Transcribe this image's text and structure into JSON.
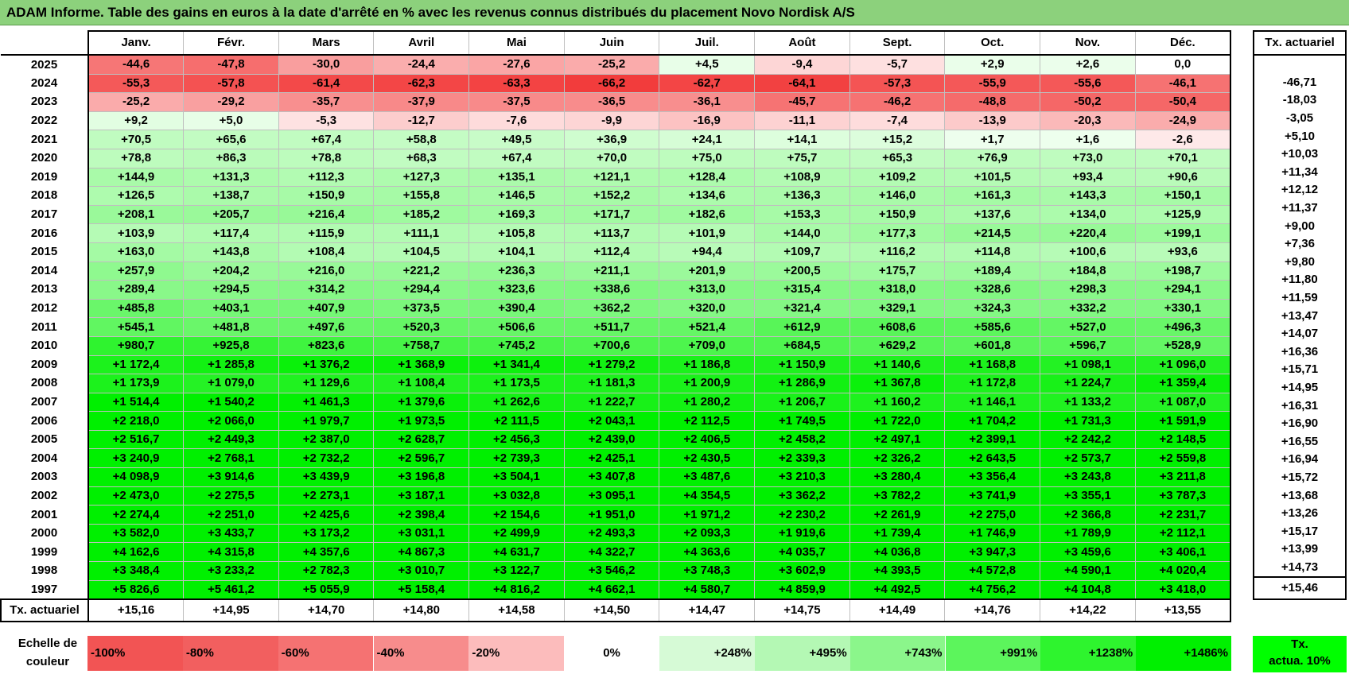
{
  "title": "ADAM Informe. Table des gains en euros à la date d'arrêté en % avec les revenus connus distribués du placement Novo Nordisk A/S",
  "months": [
    "Janv.",
    "Févr.",
    "Mars",
    "Avril",
    "Mai",
    "Juin",
    "Juil.",
    "Août",
    "Sept.",
    "Oct.",
    "Nov.",
    "Déc."
  ],
  "rate_header": "Tx. actuariel",
  "rows": [
    {
      "year": "2025",
      "values": [
        "-44,6",
        "-47,8",
        "-30,0",
        "-24,4",
        "-27,6",
        "-25,2",
        "+4,5",
        "-9,4",
        "-5,7",
        "+2,9",
        "+2,6",
        "0,0"
      ],
      "rate": ""
    },
    {
      "year": "2024",
      "values": [
        "-55,3",
        "-57,8",
        "-61,4",
        "-62,3",
        "-63,3",
        "-66,2",
        "-62,7",
        "-64,1",
        "-57,3",
        "-55,9",
        "-55,6",
        "-46,1"
      ],
      "rate": "-46,71"
    },
    {
      "year": "2023",
      "values": [
        "-25,2",
        "-29,2",
        "-35,7",
        "-37,9",
        "-37,5",
        "-36,5",
        "-36,1",
        "-45,7",
        "-46,2",
        "-48,8",
        "-50,2",
        "-50,4"
      ],
      "rate": "-18,03"
    },
    {
      "year": "2022",
      "values": [
        "+9,2",
        "+5,0",
        "-5,3",
        "-12,7",
        "-7,6",
        "-9,9",
        "-16,9",
        "-11,1",
        "-7,4",
        "-13,9",
        "-20,3",
        "-24,9"
      ],
      "rate": "-3,05"
    },
    {
      "year": "2021",
      "values": [
        "+70,5",
        "+65,6",
        "+67,4",
        "+58,8",
        "+49,5",
        "+36,9",
        "+24,1",
        "+14,1",
        "+15,2",
        "+1,7",
        "+1,6",
        "-2,6"
      ],
      "rate": "+5,10"
    },
    {
      "year": "2020",
      "values": [
        "+78,8",
        "+86,3",
        "+78,8",
        "+68,3",
        "+67,4",
        "+70,0",
        "+75,0",
        "+75,7",
        "+65,3",
        "+76,9",
        "+73,0",
        "+70,1"
      ],
      "rate": "+10,03"
    },
    {
      "year": "2019",
      "values": [
        "+144,9",
        "+131,3",
        "+112,3",
        "+127,3",
        "+135,1",
        "+121,1",
        "+128,4",
        "+108,9",
        "+109,2",
        "+101,5",
        "+93,4",
        "+90,6"
      ],
      "rate": "+11,34"
    },
    {
      "year": "2018",
      "values": [
        "+126,5",
        "+138,7",
        "+150,9",
        "+155,8",
        "+146,5",
        "+152,2",
        "+134,6",
        "+136,3",
        "+146,0",
        "+161,3",
        "+143,3",
        "+150,1"
      ],
      "rate": "+12,12"
    },
    {
      "year": "2017",
      "values": [
        "+208,1",
        "+205,7",
        "+216,4",
        "+185,2",
        "+169,3",
        "+171,7",
        "+182,6",
        "+153,3",
        "+150,9",
        "+137,6",
        "+134,0",
        "+125,9"
      ],
      "rate": "+11,37"
    },
    {
      "year": "2016",
      "values": [
        "+103,9",
        "+117,4",
        "+115,9",
        "+111,1",
        "+105,8",
        "+113,7",
        "+101,9",
        "+144,0",
        "+177,3",
        "+214,5",
        "+220,4",
        "+199,1"
      ],
      "rate": "+9,00"
    },
    {
      "year": "2015",
      "values": [
        "+163,0",
        "+143,8",
        "+108,4",
        "+104,5",
        "+104,1",
        "+112,4",
        "+94,4",
        "+109,7",
        "+116,2",
        "+114,8",
        "+100,6",
        "+93,6"
      ],
      "rate": "+7,36"
    },
    {
      "year": "2014",
      "values": [
        "+257,9",
        "+204,2",
        "+216,0",
        "+221,2",
        "+236,3",
        "+211,1",
        "+201,9",
        "+200,5",
        "+175,7",
        "+189,4",
        "+184,8",
        "+198,7"
      ],
      "rate": "+9,80"
    },
    {
      "year": "2013",
      "values": [
        "+289,4",
        "+294,5",
        "+314,2",
        "+294,4",
        "+323,6",
        "+338,6",
        "+313,0",
        "+315,4",
        "+318,0",
        "+328,6",
        "+298,3",
        "+294,1"
      ],
      "rate": "+11,80"
    },
    {
      "year": "2012",
      "values": [
        "+485,8",
        "+403,1",
        "+407,9",
        "+373,5",
        "+390,4",
        "+362,2",
        "+320,0",
        "+321,4",
        "+329,1",
        "+324,3",
        "+332,2",
        "+330,1"
      ],
      "rate": "+11,59"
    },
    {
      "year": "2011",
      "values": [
        "+545,1",
        "+481,8",
        "+497,6",
        "+520,3",
        "+506,6",
        "+511,7",
        "+521,4",
        "+612,9",
        "+608,6",
        "+585,6",
        "+527,0",
        "+496,3"
      ],
      "rate": "+13,47"
    },
    {
      "year": "2010",
      "values": [
        "+980,7",
        "+925,8",
        "+823,6",
        "+758,7",
        "+745,2",
        "+700,6",
        "+709,0",
        "+684,5",
        "+629,2",
        "+601,8",
        "+596,7",
        "+528,9"
      ],
      "rate": "+14,07"
    },
    {
      "year": "2009",
      "values": [
        "+1 172,4",
        "+1 285,8",
        "+1 376,2",
        "+1 368,9",
        "+1 341,4",
        "+1 279,2",
        "+1 186,8",
        "+1 150,9",
        "+1 140,6",
        "+1 168,8",
        "+1 098,1",
        "+1 096,0"
      ],
      "rate": "+16,36"
    },
    {
      "year": "2008",
      "values": [
        "+1 173,9",
        "+1 079,0",
        "+1 129,6",
        "+1 108,4",
        "+1 173,5",
        "+1 181,3",
        "+1 200,9",
        "+1 286,9",
        "+1 367,8",
        "+1 172,8",
        "+1 224,7",
        "+1 359,4"
      ],
      "rate": "+15,71"
    },
    {
      "year": "2007",
      "values": [
        "+1 514,4",
        "+1 540,2",
        "+1 461,3",
        "+1 379,6",
        "+1 262,6",
        "+1 222,7",
        "+1 280,2",
        "+1 206,7",
        "+1 160,2",
        "+1 146,1",
        "+1 133,2",
        "+1 087,0"
      ],
      "rate": "+14,95"
    },
    {
      "year": "2006",
      "values": [
        "+2 218,0",
        "+2 066,0",
        "+1 979,7",
        "+1 973,5",
        "+2 111,5",
        "+2 043,1",
        "+2 112,5",
        "+1 749,5",
        "+1 722,0",
        "+1 704,2",
        "+1 731,3",
        "+1 591,9"
      ],
      "rate": "+16,31"
    },
    {
      "year": "2005",
      "values": [
        "+2 516,7",
        "+2 449,3",
        "+2 387,0",
        "+2 628,7",
        "+2 456,3",
        "+2 439,0",
        "+2 406,5",
        "+2 458,2",
        "+2 497,1",
        "+2 399,1",
        "+2 242,2",
        "+2 148,5"
      ],
      "rate": "+16,90"
    },
    {
      "year": "2004",
      "values": [
        "+3 240,9",
        "+2 768,1",
        "+2 732,2",
        "+2 596,7",
        "+2 739,3",
        "+2 425,1",
        "+2 430,5",
        "+2 339,3",
        "+2 326,2",
        "+2 643,5",
        "+2 573,7",
        "+2 559,8"
      ],
      "rate": "+16,55"
    },
    {
      "year": "2003",
      "values": [
        "+4 098,9",
        "+3 914,6",
        "+3 439,9",
        "+3 196,8",
        "+3 504,1",
        "+3 407,8",
        "+3 487,6",
        "+3 210,3",
        "+3 280,4",
        "+3 356,4",
        "+3 243,8",
        "+3 211,8"
      ],
      "rate": "+16,94"
    },
    {
      "year": "2002",
      "values": [
        "+2 473,0",
        "+2 275,5",
        "+2 273,1",
        "+3 187,1",
        "+3 032,8",
        "+3 095,1",
        "+4 354,5",
        "+3 362,2",
        "+3 782,2",
        "+3 741,9",
        "+3 355,1",
        "+3 787,3"
      ],
      "rate": "+15,72"
    },
    {
      "year": "2001",
      "values": [
        "+2 274,4",
        "+2 251,0",
        "+2 425,6",
        "+2 398,4",
        "+2 154,6",
        "+1 951,0",
        "+1 971,2",
        "+2 230,2",
        "+2 261,9",
        "+2 275,0",
        "+2 366,8",
        "+2 231,7"
      ],
      "rate": "+13,68"
    },
    {
      "year": "2000",
      "values": [
        "+3 582,0",
        "+3 433,7",
        "+3 173,2",
        "+3 031,1",
        "+2 499,9",
        "+2 493,3",
        "+2 093,3",
        "+1 919,6",
        "+1 739,4",
        "+1 746,9",
        "+1 789,9",
        "+2 112,1"
      ],
      "rate": "+13,26"
    },
    {
      "year": "1999",
      "values": [
        "+4 162,6",
        "+4 315,8",
        "+4 357,6",
        "+4 867,3",
        "+4 631,7",
        "+4 322,7",
        "+4 363,6",
        "+4 035,7",
        "+4 036,8",
        "+3 947,3",
        "+3 459,6",
        "+3 406,1"
      ],
      "rate": "+15,17"
    },
    {
      "year": "1998",
      "values": [
        "+3 348,4",
        "+3 233,2",
        "+2 782,3",
        "+3 010,7",
        "+3 122,7",
        "+3 546,2",
        "+3 748,3",
        "+3 602,9",
        "+4 393,5",
        "+4 572,8",
        "+4 590,1",
        "+4 020,4"
      ],
      "rate": "+13,99"
    },
    {
      "year": "1997",
      "values": [
        "+5 826,6",
        "+5 461,2",
        "+5 055,9",
        "+5 158,4",
        "+4 816,2",
        "+4 662,1",
        "+4 580,7",
        "+4 859,9",
        "+4 492,5",
        "+4 756,2",
        "+4 104,8",
        "+3 418,0"
      ],
      "rate": "+14,73"
    }
  ],
  "footer": {
    "label": "Tx. actuariel",
    "values": [
      "+15,16",
      "+14,95",
      "+14,70",
      "+14,80",
      "+14,58",
      "+14,50",
      "+14,47",
      "+14,75",
      "+14,49",
      "+14,76",
      "+14,22",
      "+13,55"
    ],
    "rate": "+15,46"
  },
  "legend": {
    "label_line1": "Echelle de",
    "label_line2": "couleur",
    "swatches": [
      {
        "label": "-100%",
        "color": "#f25454",
        "align": "left"
      },
      {
        "label": "-80%",
        "color": "#f25f5f",
        "align": "left"
      },
      {
        "label": "-60%",
        "color": "#f57272",
        "align": "left"
      },
      {
        "label": "-40%",
        "color": "#f78c8c",
        "align": "left"
      },
      {
        "label": "-20%",
        "color": "#fcbcbc",
        "align": "left"
      },
      {
        "label": "0%",
        "color": "#ffffff",
        "align": "center"
      },
      {
        "label": "+248%",
        "color": "#d6fad6",
        "align": "right"
      },
      {
        "label": "+495%",
        "color": "#b4f8b4",
        "align": "right"
      },
      {
        "label": "+743%",
        "color": "#8bf68b",
        "align": "right"
      },
      {
        "label": "+991%",
        "color": "#5cf55c",
        "align": "right"
      },
      {
        "label": "+1238%",
        "color": "#2ef42e",
        "align": "right"
      },
      {
        "label": "+1486%",
        "color": "#00f000",
        "align": "right"
      }
    ],
    "rate_line1": "Tx.",
    "rate_line2": "actua. 10%",
    "rate_color": "#00ff00"
  },
  "colors": {
    "title_bg": "#8cd17c",
    "neg_dark": "#f43b3b",
    "pos_full": "#00f000"
  }
}
